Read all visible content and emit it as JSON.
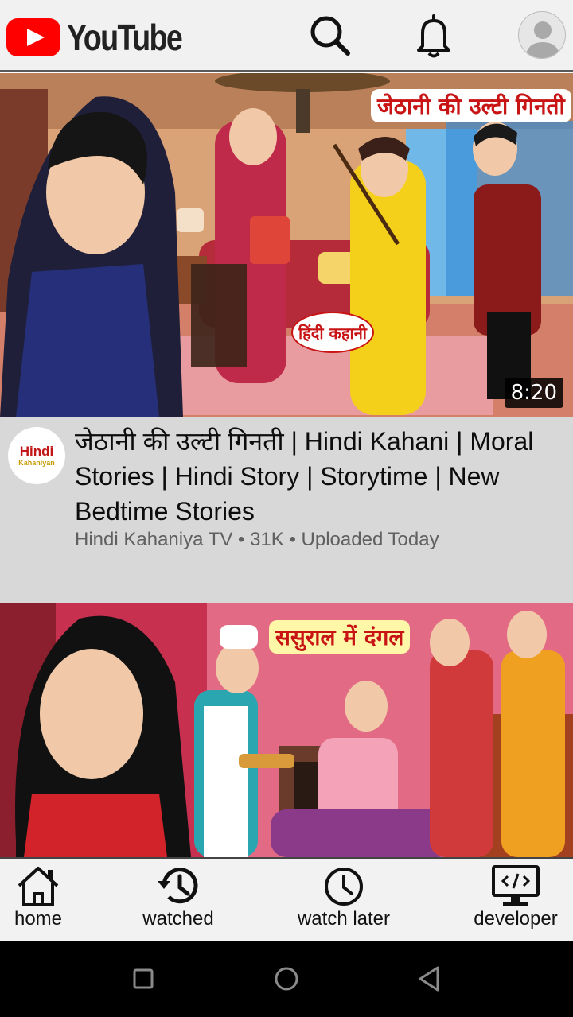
{
  "app": {
    "brand": "YouTube"
  },
  "header_icons": {
    "search": "search-icon",
    "notifications": "bell-icon",
    "account": "account-avatar-icon"
  },
  "videos": [
    {
      "thumbnail_text": "जेठानी की उल्टी गिनती",
      "thumbnail_badge": "हिंदी कहानी",
      "duration": "8:20",
      "title": "जेठानी की उल्टी गिनती | Hindi Kahani | Moral Stories | Hindi Story | Storytime | New Bedtime Stories",
      "channel": "Hindi Kahaniya TV",
      "views": "31K",
      "uploaded": "Uploaded Today",
      "channel_avatar_text": "Hindi",
      "channel_avatar_sub": "Kahaniyan"
    },
    {
      "thumbnail_text": "ससुराल में दंगल"
    }
  ],
  "bottom_nav": [
    {
      "label": "home",
      "icon": "home-icon"
    },
    {
      "label": "watched",
      "icon": "history-icon"
    },
    {
      "label": "watch later",
      "icon": "clock-icon"
    },
    {
      "label": "developer",
      "icon": "developer-monitor-icon"
    }
  ],
  "colors": {
    "brand_red": "#ff0000",
    "meta_bg": "#d8d8d8",
    "topbar_bg": "#f1f1f1"
  }
}
